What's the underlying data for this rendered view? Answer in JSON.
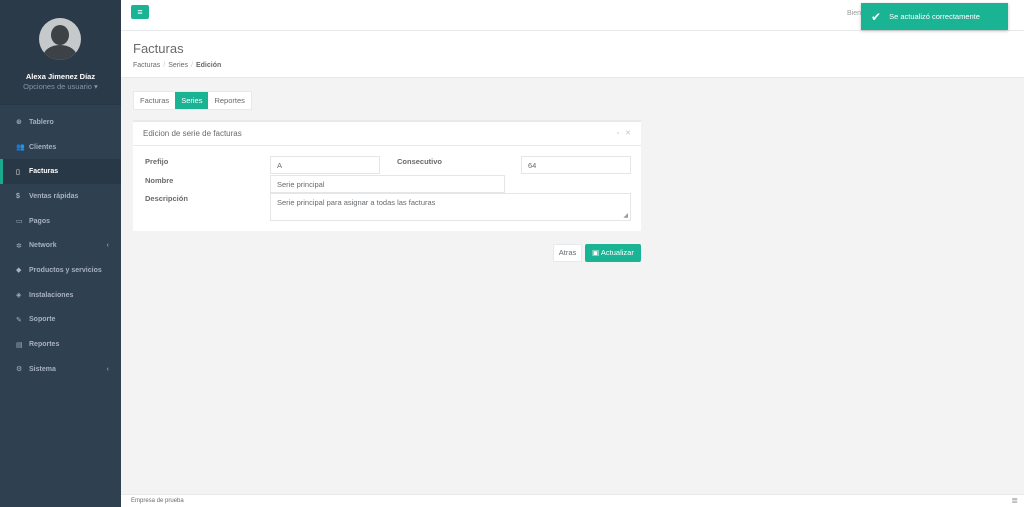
{
  "sidebar": {
    "user_name": "Alexa Jimenez Díaz",
    "user_options": "Opciones de usuario ▾",
    "items": [
      {
        "icon": "⊛",
        "label": "Tablero",
        "active": false,
        "caret": ""
      },
      {
        "icon": "👥",
        "label": "Clientes",
        "active": false,
        "caret": ""
      },
      {
        "icon": "▯",
        "label": "Facturas",
        "active": true,
        "caret": ""
      },
      {
        "icon": "$",
        "label": "Ventas rápidas",
        "active": false,
        "caret": ""
      },
      {
        "icon": "▭",
        "label": "Pagos",
        "active": false,
        "caret": ""
      },
      {
        "icon": "✲",
        "label": "Network",
        "active": false,
        "caret": "‹"
      },
      {
        "icon": "◆",
        "label": "Productos y servicios",
        "active": false,
        "caret": ""
      },
      {
        "icon": "◈",
        "label": "Instalaciones",
        "active": false,
        "caret": ""
      },
      {
        "icon": "✎",
        "label": "Soporte",
        "active": false,
        "caret": ""
      },
      {
        "icon": "▤",
        "label": "Reportes",
        "active": false,
        "caret": ""
      },
      {
        "icon": "⚙",
        "label": "Sistema",
        "active": false,
        "caret": "‹"
      }
    ]
  },
  "topbar": {
    "menu_icon": "≡",
    "welcome": "Bien"
  },
  "heading": {
    "title": "Facturas",
    "crumb1": "Facturas",
    "crumb2": "Series",
    "crumb3": "Edición"
  },
  "tabs": [
    {
      "label": "Facturas",
      "active": false
    },
    {
      "label": "Series",
      "active": true
    },
    {
      "label": "Reportes",
      "active": false
    }
  ],
  "panel": {
    "title": "Edicion de serie de facturas",
    "tools": "▫ ✕"
  },
  "form": {
    "prefijo_label": "Prefijo",
    "prefijo_value": "A",
    "consecutivo_label": "Consecutivo",
    "consecutivo_value": "64",
    "nombre_label": "Nombre",
    "nombre_value": "Serie principal",
    "descripcion_label": "Descripción",
    "descripcion_value": "Serie principal para asignar a todas las facturas"
  },
  "buttons": {
    "back": "Atras",
    "update": "Actualizar",
    "update_icon": "▣"
  },
  "toast": {
    "check": "✔",
    "message": "Se actualizó correctamente"
  },
  "footer": {
    "company": "Empresa de prueba",
    "icon": "≣"
  },
  "colors": {
    "accent": "#1ab394",
    "sidebar": "#2f4050"
  }
}
